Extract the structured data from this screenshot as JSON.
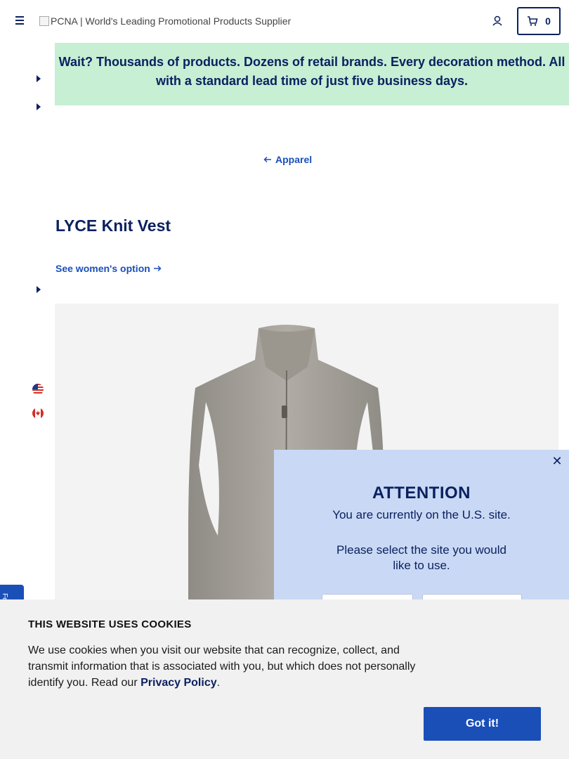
{
  "header": {
    "logo_alt": "PCNA | World's Leading Promotional Products Supplier",
    "cart_count": "0"
  },
  "promo": {
    "text": "Wait? Thousands of products. Dozens of retail brands. Every decoration method. All with a standard lead time of just five business days."
  },
  "breadcrumb": {
    "back_label": "Apparel"
  },
  "product": {
    "title": "LYCE Knit Vest",
    "women_option_link": "See women's option"
  },
  "feedback": {
    "label": "Feedback"
  },
  "attention": {
    "title": "ATTENTION",
    "line1": "You are currently on the U.S. site.",
    "line2": "Please select the site you would like to use."
  },
  "cookies": {
    "title": "THIS WEBSITE USES COOKIES",
    "body": "We use cookies when you visit our website that can recognize, collect, and transmit information that is associated with you, but which does not personally identify you. Read our ",
    "link": "Privacy Policy",
    "end": ".",
    "button": "Got it!"
  },
  "colors": {
    "navy": "#0b2160",
    "link_blue": "#1a4fb8",
    "promo_green": "#c6efd4",
    "attention_bg": "#c9d9f5",
    "cookie_bg": "#f1f1f1",
    "vest_gray": "#a39f98"
  },
  "icons": [
    "menu-icon",
    "account-icon",
    "cart-icon",
    "arrow-left-icon",
    "arrow-right-icon",
    "caret-right-icon",
    "us-flag-icon",
    "canada-flag-icon",
    "close-icon"
  ]
}
